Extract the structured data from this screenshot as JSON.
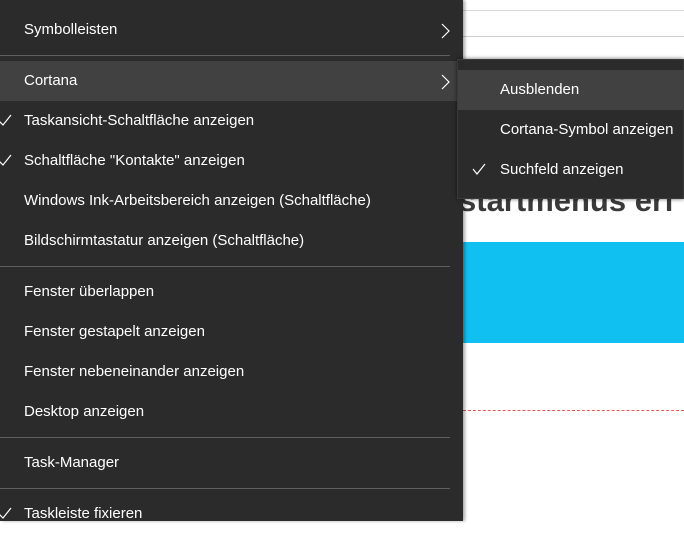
{
  "background": {
    "heading_fragment": "startmenüs erf"
  },
  "context_menu": {
    "items": [
      {
        "label": "Symbolleisten",
        "has_submenu": true,
        "checked": false
      },
      {
        "label": "Cortana",
        "has_submenu": true,
        "checked": false,
        "highlighted": true
      },
      {
        "label": "Taskansicht-Schaltfläche anzeigen",
        "checked": true
      },
      {
        "label": "Schaltfläche \"Kontakte\" anzeigen",
        "checked": true
      },
      {
        "label": "Windows Ink-Arbeitsbereich anzeigen (Schaltfläche)",
        "checked": false
      },
      {
        "label": "Bildschirmtastatur anzeigen (Schaltfläche)",
        "checked": false
      },
      {
        "label": "Fenster überlappen",
        "checked": false
      },
      {
        "label": "Fenster gestapelt anzeigen",
        "checked": false
      },
      {
        "label": "Fenster nebeneinander anzeigen",
        "checked": false
      },
      {
        "label": "Desktop anzeigen",
        "checked": false
      },
      {
        "label": "Task-Manager",
        "checked": false
      },
      {
        "label": "Taskleiste fixieren",
        "checked": true
      }
    ]
  },
  "cortana_submenu": {
    "items": [
      {
        "label": "Ausblenden",
        "checked": false,
        "highlighted": true
      },
      {
        "label": "Cortana-Symbol anzeigen",
        "checked": false
      },
      {
        "label": "Suchfeld anzeigen",
        "checked": true
      }
    ]
  },
  "colors": {
    "menu_background": "#2b2b2b",
    "menu_hover": "#414141",
    "menu_text": "#ffffff",
    "separator": "#5f5f5f",
    "banner": "#10c0f0"
  }
}
